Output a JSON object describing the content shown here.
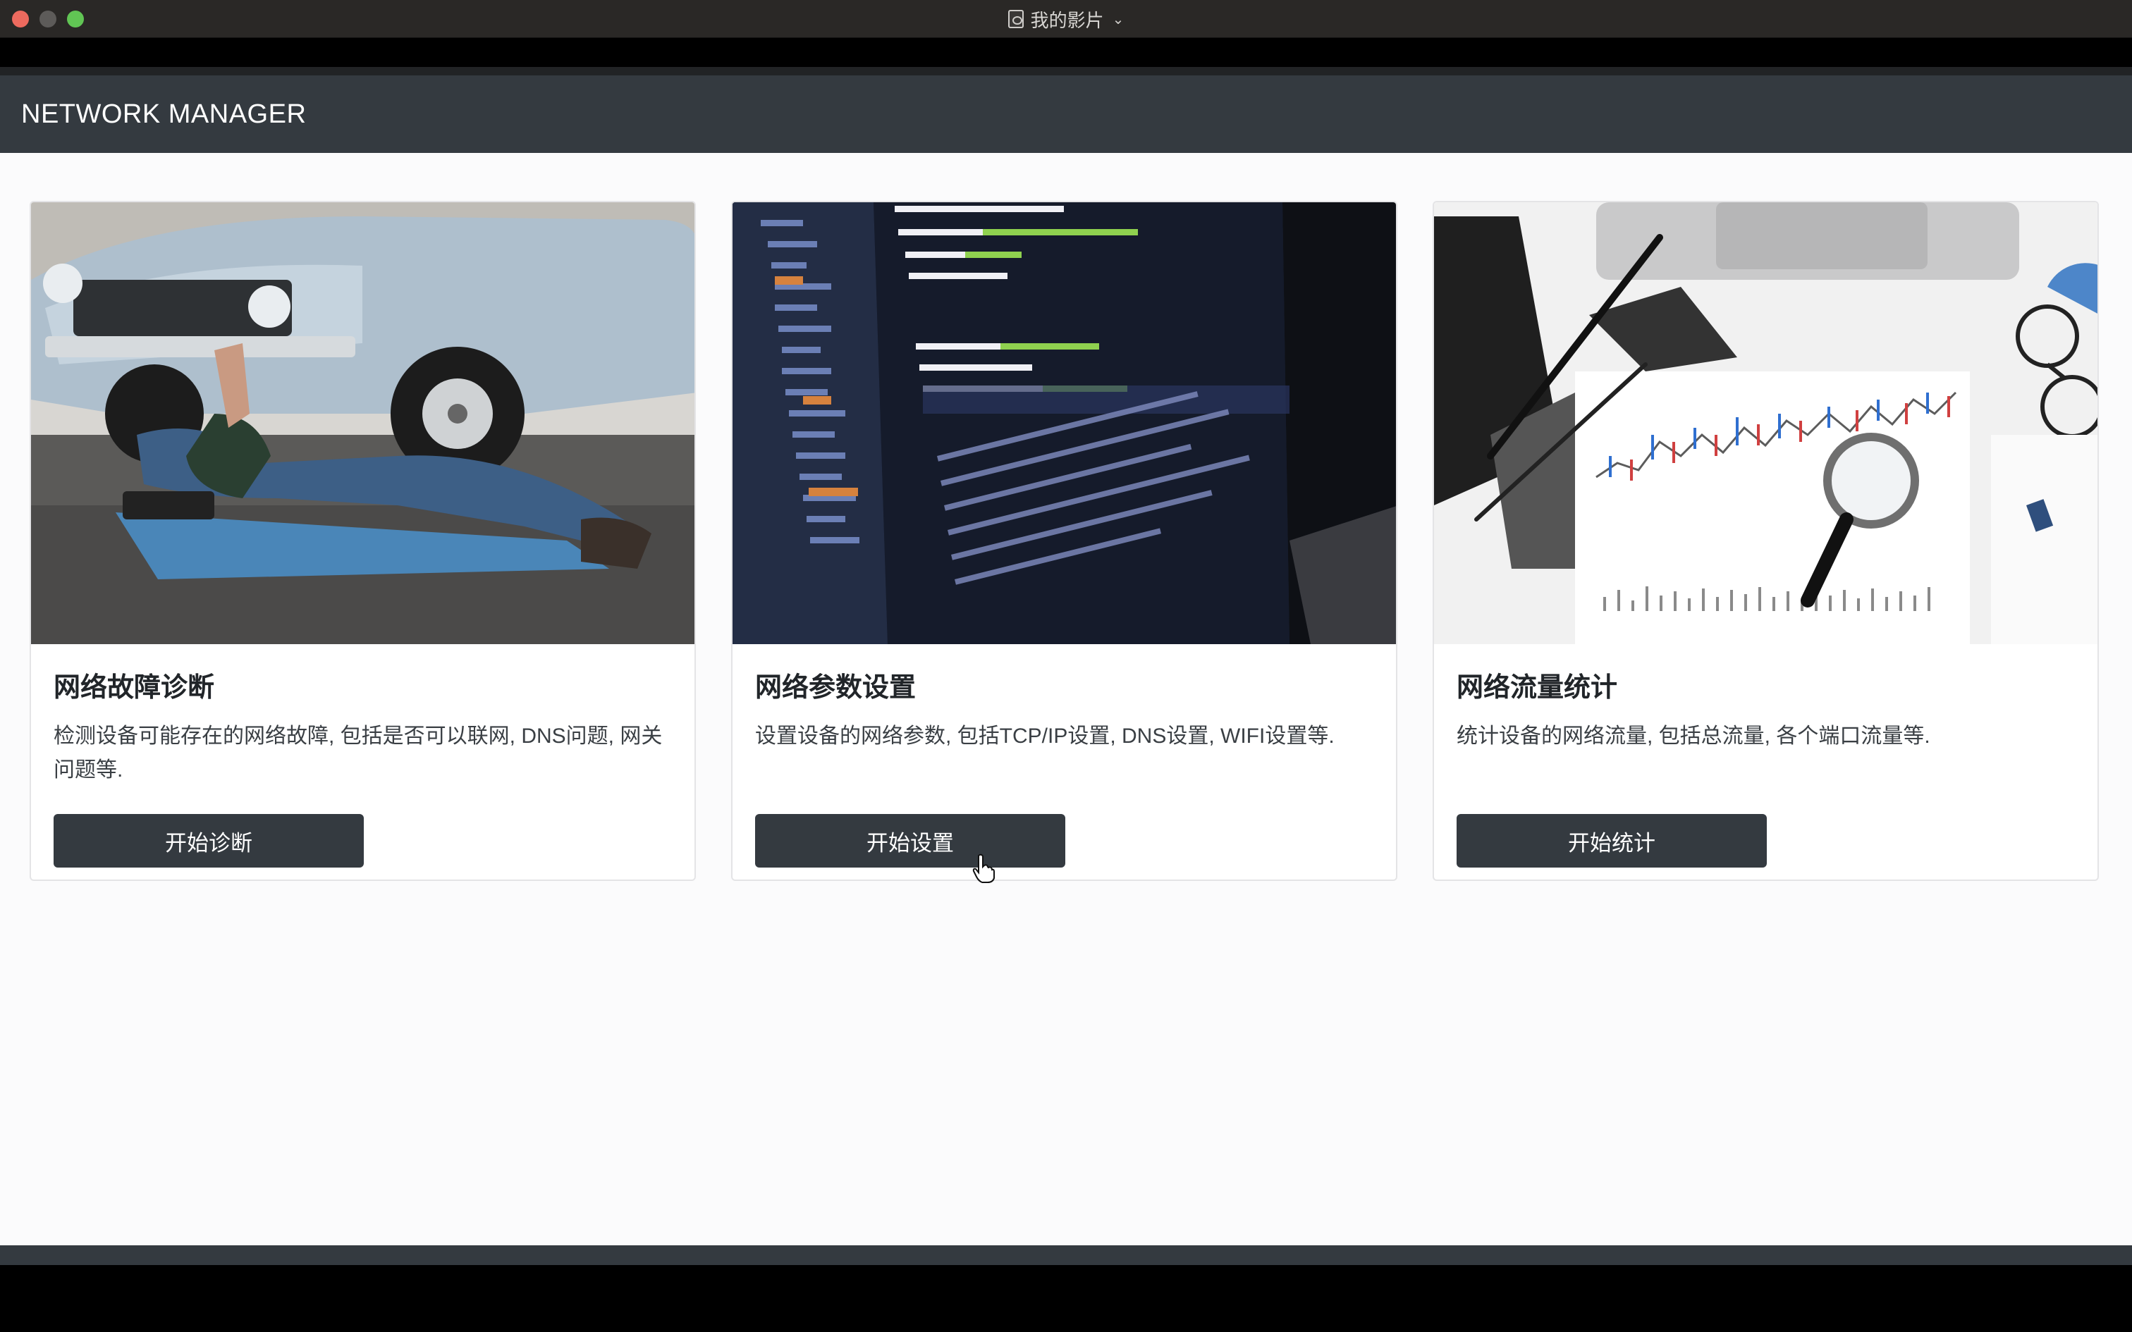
{
  "window": {
    "title": "我的影片"
  },
  "navbar": {
    "brand": "NETWORK MANAGER"
  },
  "cards": [
    {
      "image": "mechanic-under-car-photo",
      "title": "网络故障诊断",
      "text": "检测设备可能存在的网络故障, 包括是否可以联网, DNS问题, 网关问题等.",
      "button": "开始诊断"
    },
    {
      "image": "code-on-laptop-photo",
      "title": "网络参数设置",
      "text": "设置设备的网络参数, 包括TCP/IP设置, DNS设置, WIFI设置等.",
      "button": "开始设置"
    },
    {
      "image": "charts-with-magnifier-photo",
      "title": "网络流量统计",
      "text": "统计设备的网络流量, 包括总流量, 各个端口流量等.",
      "button": "开始统计"
    }
  ],
  "colors": {
    "navbar": "#343a40",
    "button": "#343a40",
    "page_bg": "#fbfbfc"
  }
}
